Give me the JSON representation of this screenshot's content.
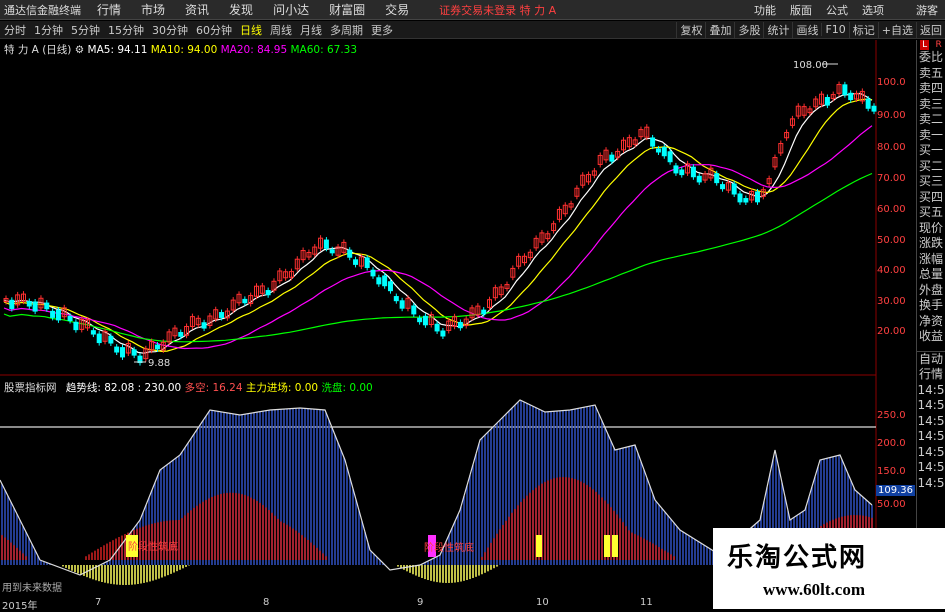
{
  "menubar": {
    "app_title": "通达信金融终端",
    "items": [
      "行情",
      "市场",
      "资讯",
      "发现",
      "问小达",
      "财富圈",
      "交易"
    ],
    "notice": "证券交易未登录  特 力 A",
    "right_items": [
      "功能",
      "版面",
      "公式",
      "选项",
      "游客"
    ]
  },
  "toolbar": {
    "periods": [
      "分时",
      "1分钟",
      "5分钟",
      "15分钟",
      "30分钟",
      "60分钟",
      "日线",
      "周线",
      "月线",
      "多周期",
      "更多"
    ],
    "active": "日线",
    "right_items": [
      "复权",
      "叠加",
      "多股",
      "统计",
      "画线",
      "F10",
      "标记",
      "+自选",
      "返回"
    ]
  },
  "main_info": {
    "stock": "特 力 A",
    "period": "(日线)",
    "ma5": "MA5: 94.11",
    "ma10": "MA10: 94.00",
    "ma20": "MA20: 84.95",
    "ma60": "MA60: 67.33",
    "high_label": "108.00",
    "low_label": "9.88"
  },
  "price_axis": [
    "100.0",
    "90.00",
    "80.00",
    "70.00",
    "60.00",
    "50.00",
    "40.00",
    "30.00",
    "20.00"
  ],
  "indicator_info": {
    "name": "股票指标网",
    "trend": "趋势线: 82.08 : 230.00",
    "duokong": "多空: 16.24",
    "zhuli": "主力进场: 0.00",
    "xipan": "洗盘: 0.00",
    "current_value": "109.36",
    "no_data": "用到未来数据",
    "label_a": "阶段性筑底",
    "label_b": "阶段性筑底"
  },
  "indicator_axis": [
    "250.0",
    "200.0",
    "150.0",
    "100.0",
    "50.00"
  ],
  "side_panel": [
    "委比",
    "卖五",
    "卖四",
    "卖三",
    "卖二",
    "卖一",
    "买一",
    "买二",
    "买三",
    "买四",
    "买五",
    "现价",
    "涨跌",
    "涨幅",
    "总量",
    "外盘",
    "换手",
    "净资",
    "收益"
  ],
  "side_panel_lower": [
    "自动",
    "行情",
    "14:5",
    "14:5",
    "14:5",
    "14:5",
    "14:5",
    "14:5",
    "14:5"
  ],
  "side_top": {
    "l": "L",
    "r": "R"
  },
  "xaxis": [
    "2015年",
    "7",
    "8",
    "9",
    "10",
    "11"
  ],
  "watermark": {
    "line1": "乐淘公式网",
    "line2": "www.60lt.com"
  },
  "colors": {
    "up": "#ff3030",
    "down": "#00ffff",
    "ma5": "#ffffff",
    "ma10": "#ffff00",
    "ma20": "#ff00ff",
    "ma60": "#00ff00"
  }
}
